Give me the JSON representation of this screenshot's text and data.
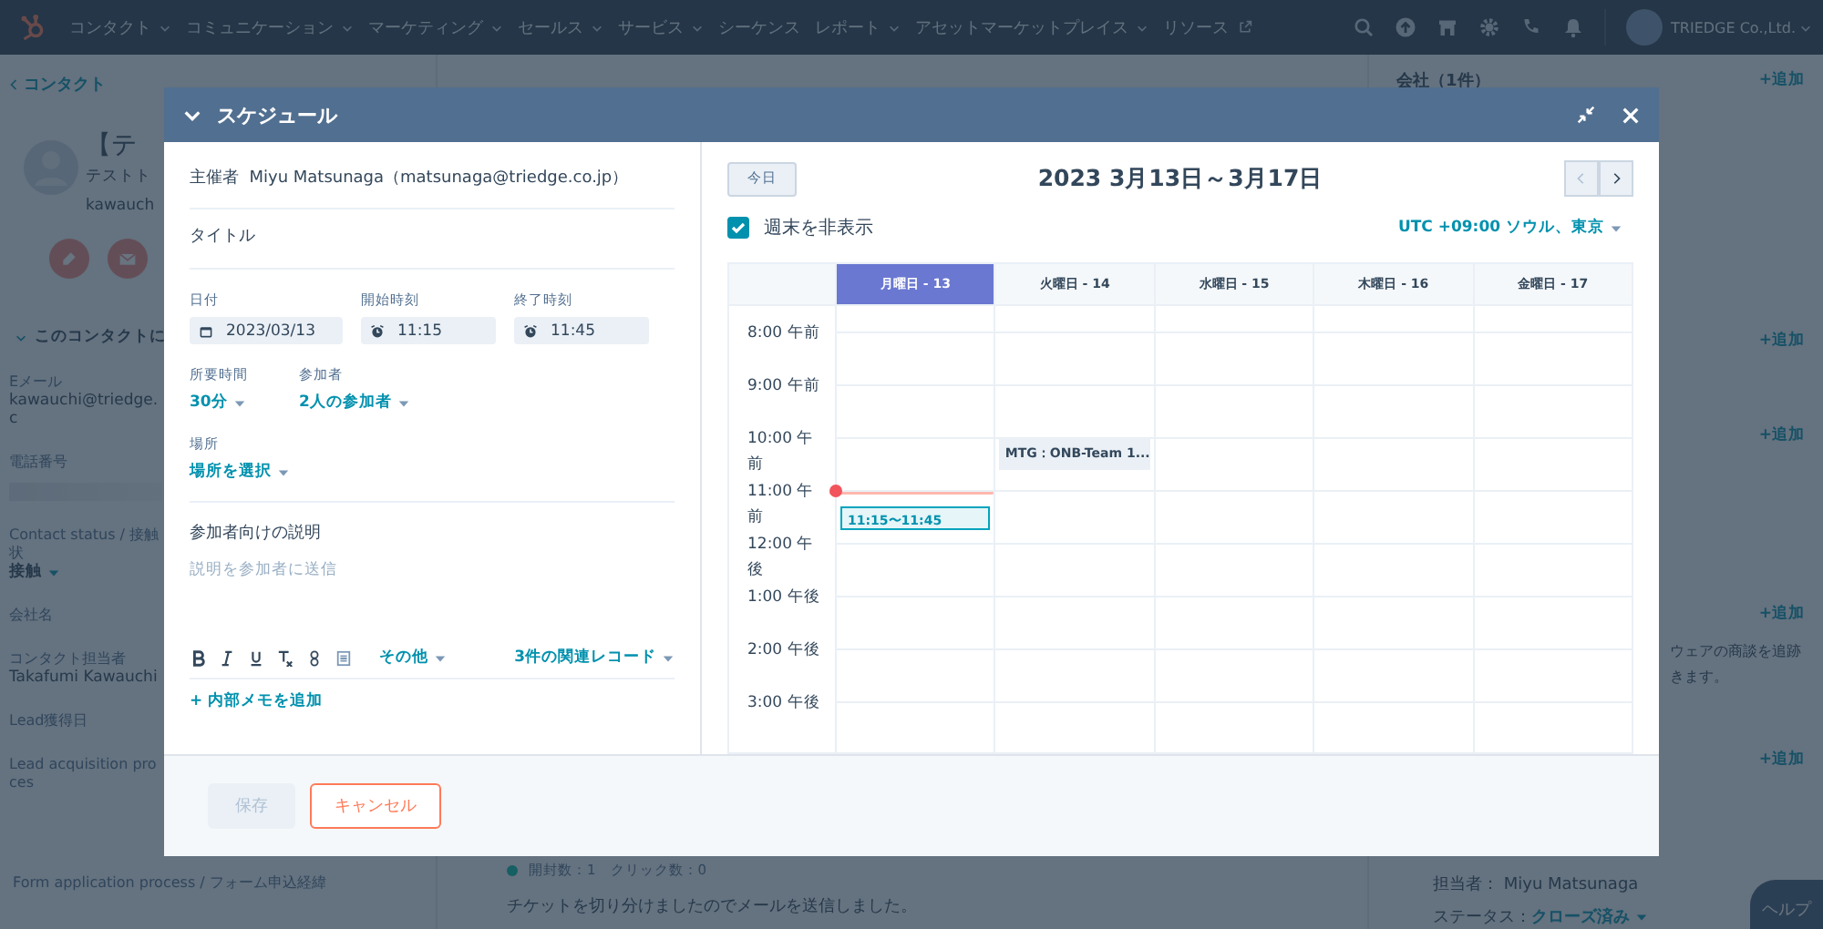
{
  "nav": {
    "items": [
      {
        "label": "コンタクト",
        "kind": "dropdown"
      },
      {
        "label": "コミュニケーション",
        "kind": "dropdown"
      },
      {
        "label": "マーケティング",
        "kind": "dropdown"
      },
      {
        "label": "セールス",
        "kind": "dropdown"
      },
      {
        "label": "サービス",
        "kind": "dropdown"
      },
      {
        "label": "シーケンス",
        "kind": "plain"
      },
      {
        "label": "レポート",
        "kind": "dropdown"
      },
      {
        "label": "アセットマーケットプレイス",
        "kind": "dropdown"
      },
      {
        "label": "リソース",
        "kind": "external"
      }
    ],
    "account": "TRIEDGE Co.,Ltd."
  },
  "contact_sidebar": {
    "back_link": "コンタクト",
    "name": "【テ",
    "subtitle": "テストト",
    "email_short": "kawauch",
    "section": "このコンタクトに",
    "fields": [
      {
        "label": "Eメール",
        "value": "kawauchi@triedge.c",
        "kind": "text"
      },
      {
        "label": "電話番号",
        "kind": "hidden"
      },
      {
        "label": "Contact status / 接触状",
        "value": "接触",
        "kind": "dropdown"
      },
      {
        "label": "会社名",
        "kind": "empty"
      },
      {
        "label": "コンタクト担当者",
        "value": "Takafumi Kawauchi",
        "kind": "text"
      },
      {
        "label": "Lead獲得日",
        "kind": "empty"
      },
      {
        "label": "Lead acquisition proces",
        "kind": "empty"
      }
    ],
    "bottom_label": "Form application process / フォーム申込経緯"
  },
  "activity": {
    "stats": "開封数：1　クリック数：0",
    "message": "チケットを切り分けましたのでメールを送信しました。"
  },
  "right_panel": {
    "title": "会社（1件）",
    "add_links": [
      "+追加",
      "+追加",
      "+追加",
      "+追加",
      "+追加"
    ],
    "note_lines": [
      "ウェアの商談を追跡",
      "きます。"
    ],
    "owner": "担当者：  Miyu Matsunaga",
    "status_label": "ステータス：",
    "status_value": "クローズ済み",
    "help": "ヘルプ"
  },
  "modal": {
    "title": "スケジュール",
    "organizer_label": "主催者",
    "organizer": "Miyu Matsunaga（matsunaga@triedge.co.jp）",
    "title_field": {
      "placeholder": "タイトル"
    },
    "date": {
      "label": "日付",
      "value": "2023/03/13"
    },
    "start": {
      "label": "開始時刻",
      "value": "11:15"
    },
    "end": {
      "label": "終了時刻",
      "value": "11:45"
    },
    "duration": {
      "label": "所要時間",
      "value": "30分"
    },
    "attendees": {
      "label": "参加者",
      "value": "2人の参加者"
    },
    "location": {
      "label": "場所",
      "value": "場所を選択"
    },
    "description": {
      "label": "参加者向けの説明",
      "placeholder": "説明を参加者に送信"
    },
    "toolbar": {
      "more": "その他",
      "records": "3件の関連レコード"
    },
    "add_note": "+ 内部メモを追加",
    "save": {
      "label": "保存",
      "disabled": true
    },
    "cancel": "キャンセル",
    "calendar": {
      "today": "今日",
      "range": "2023 3月13日～3月17日",
      "hide_weekends": {
        "label": "週末を非表示",
        "checked": true
      },
      "timezone": "UTC +09:00 ソウル、東京",
      "days": [
        {
          "label": "月曜日 - 13",
          "selected": true
        },
        {
          "label": "火曜日 - 14",
          "selected": false
        },
        {
          "label": "水曜日 - 15",
          "selected": false
        },
        {
          "label": "木曜日 - 16",
          "selected": false
        },
        {
          "label": "金曜日 - 17",
          "selected": false
        }
      ],
      "hours": [
        {
          "label": "8:00 午前",
          "now": false
        },
        {
          "label": "9:00 午前",
          "now": false
        },
        {
          "label": "10:00 午前",
          "now": false,
          "cells": [
            null,
            {
              "label": "MTG：ONB-Team 1...",
              "kind": "meeting"
            },
            null,
            null,
            null
          ]
        },
        {
          "label": "11:00 午前",
          "now": true,
          "cells": [
            {
              "label": "11:15〜11:45",
              "kind": "draft"
            },
            null,
            null,
            null,
            null
          ]
        },
        {
          "label": "12:00 午後",
          "now": false
        },
        {
          "label": "1:00 午後",
          "now": false
        },
        {
          "label": "2:00 午後",
          "now": false
        },
        {
          "label": "3:00 午後",
          "now": false
        }
      ]
    }
  }
}
